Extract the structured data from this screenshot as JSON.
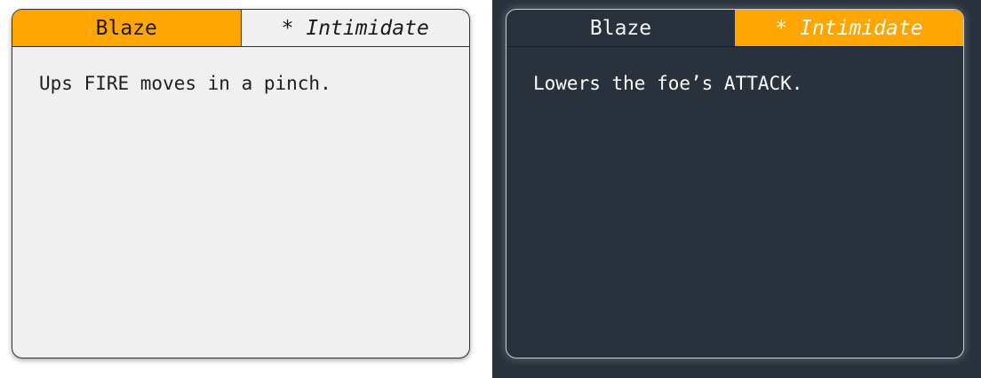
{
  "light_panel": {
    "tabs": [
      {
        "label": "Blaze",
        "active": true
      },
      {
        "label": "* Intimidate",
        "active": false
      }
    ],
    "description": "Ups FIRE moves in a pinch."
  },
  "dark_panel": {
    "tabs": [
      {
        "label": "Blaze",
        "active": false
      },
      {
        "label": "* Intimidate",
        "active": true
      }
    ],
    "description": "Lowers the foe’s ATTACK."
  },
  "colors": {
    "accent": "#ffa500",
    "light_background": "#f0f0f0",
    "dark_background": "#29323c"
  }
}
